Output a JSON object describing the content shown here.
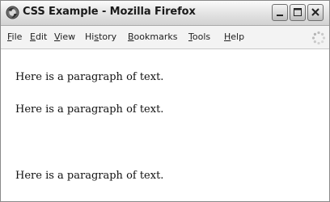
{
  "window": {
    "title": "CSS Example - Mozilla Firefox"
  },
  "menubar": {
    "items": [
      {
        "prefix": "",
        "accel": "F",
        "rest": "ile"
      },
      {
        "prefix": "",
        "accel": "E",
        "rest": "dit"
      },
      {
        "prefix": "",
        "accel": "V",
        "rest": "iew"
      },
      {
        "prefix": "Hi",
        "accel": "s",
        "rest": "tory"
      },
      {
        "prefix": "",
        "accel": "B",
        "rest": "ookmarks"
      },
      {
        "prefix": "",
        "accel": "T",
        "rest": "ools"
      },
      {
        "prefix": "",
        "accel": "H",
        "rest": "elp"
      }
    ]
  },
  "content": {
    "paragraphs": [
      "Here is a paragraph of text.",
      "Here is a paragraph of text.",
      "Here is a paragraph of text."
    ]
  },
  "icons": {
    "app": "firefox-icon",
    "minimize": "minimize-icon",
    "maximize": "maximize-icon",
    "close": "close-icon",
    "throbber": "throbber-icon"
  }
}
